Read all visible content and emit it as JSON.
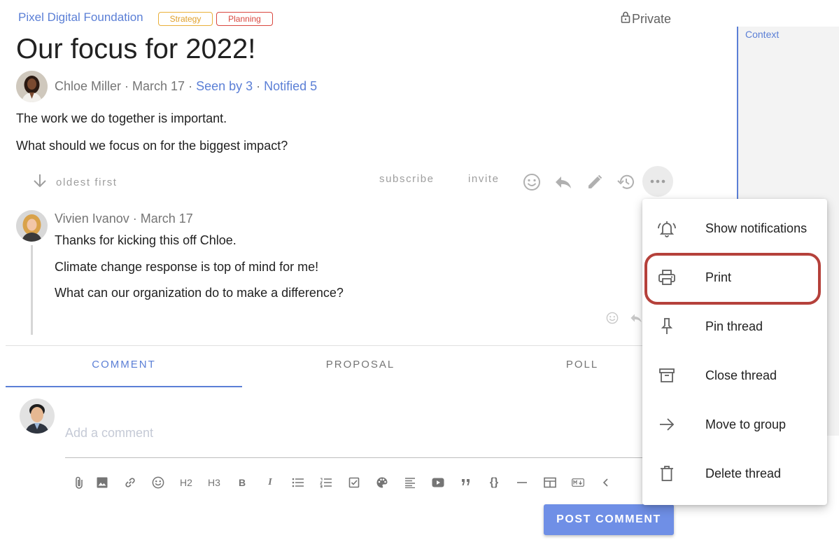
{
  "header": {
    "group_name": "Pixel Digital Foundation",
    "tags": [
      "Strategy",
      "Planning"
    ],
    "visibility": "Private",
    "context_label": "Context"
  },
  "thread": {
    "title": "Our focus for 2022!",
    "author": "Chloe Miller",
    "date": "March 17",
    "seen_by": "Seen by 3",
    "notified": "Notified 5",
    "sep": " · ",
    "body": [
      "The work we do together is important.",
      "What should we focus on for the biggest impact?"
    ]
  },
  "actions": {
    "sort_label": "oldest first",
    "subscribe": "subscribe",
    "invite": "invite",
    "icons": [
      "arrow-down-icon",
      "emoji-icon",
      "reply-icon",
      "edit-icon",
      "history-icon",
      "more-icon"
    ]
  },
  "comment": {
    "author": "Vivien Ivanov",
    "date": "March 17",
    "body": [
      "Thanks for kicking this off Chloe.",
      "Climate change response is top of mind for me!",
      "What can our organization do to make a difference?"
    ]
  },
  "composer": {
    "tabs": [
      "COMMENT",
      "PROPOSAL",
      "POLL"
    ],
    "active_tab": "COMMENT",
    "placeholder": "Add a comment",
    "toolbar": [
      "attach-icon",
      "image-icon",
      "link-icon",
      "emoji-icon",
      "H2",
      "H3",
      "B",
      "I",
      "bullet-list-icon",
      "numbered-list-icon",
      "checklist-icon",
      "palette-icon",
      "align-icon",
      "video-icon",
      "quote-icon",
      "{}",
      "horizontal-rule-icon",
      "table-icon",
      "markdown-icon",
      "collapse-icon"
    ],
    "post_label": "POST COMMENT"
  },
  "menu": {
    "items": [
      {
        "label": "Show notifications",
        "icon": "bell-icon"
      },
      {
        "label": "Print",
        "icon": "printer-icon"
      },
      {
        "label": "Pin thread",
        "icon": "pin-icon"
      },
      {
        "label": "Close thread",
        "icon": "archive-icon"
      },
      {
        "label": "Move to group",
        "icon": "arrow-right-icon"
      },
      {
        "label": "Delete thread",
        "icon": "trash-icon"
      }
    ],
    "highlighted": "Print"
  },
  "colors": {
    "accent": "#5b7fd6",
    "strategy_tag": "#e0a02a",
    "planning_tag": "#d9473f",
    "highlight_ring": "#b5413b",
    "post_button": "#6f8fe6"
  }
}
